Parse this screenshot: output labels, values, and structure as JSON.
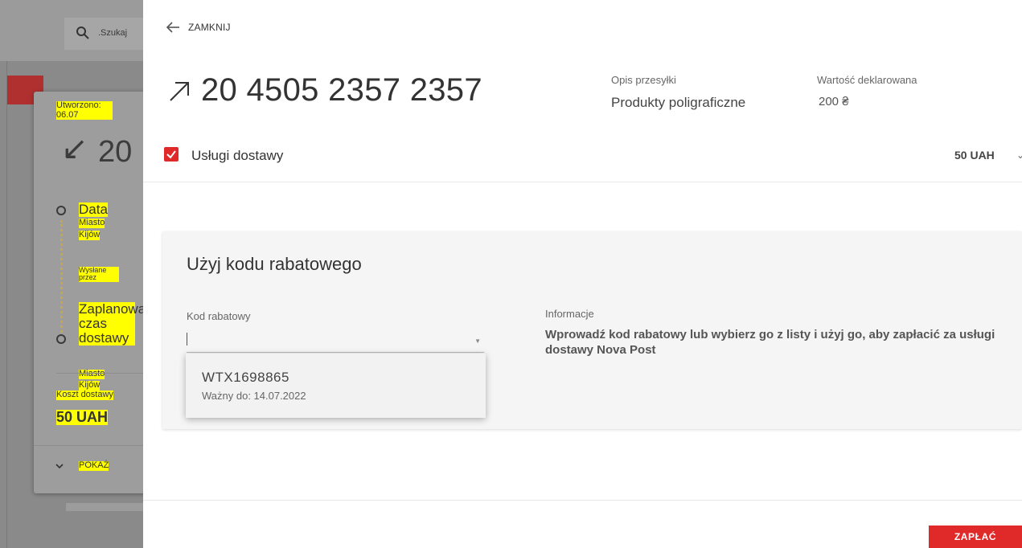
{
  "background": {
    "search_placeholder": ".Szukaj",
    "card": {
      "created": "Utworzono: 06.07",
      "arrow": "↙",
      "tracking_partial": "20",
      "data_label": "Data",
      "city_label_1": "Miasto",
      "city_value_1": "Kijów",
      "sent_by": "Wysłane przez",
      "planned_label": "Zaplanowany czas dostawy",
      "city_label_2": "Miasto",
      "city_value_2": "Kijów",
      "cost_label": "Koszt dostawy",
      "cost_value": "50 UAH",
      "show_label": "POKAŻ"
    }
  },
  "header": {
    "close_label": "ZAMKNIJ"
  },
  "shipment": {
    "tracking_number": "20 4505 2357 2357",
    "description_label": "Opis przesyłki",
    "description_value": "Produkty poligraficzne",
    "declared_value_label": "Wartość deklarowana",
    "declared_value": "200 ₴"
  },
  "services": {
    "label": "Usługi dostawy",
    "price": "50 UAH",
    "checked": true
  },
  "discount": {
    "title": "Użyj kodu rabatowego",
    "code_label": "Kod rabatowy",
    "code_value": "",
    "info_label": "Informacje",
    "info_text": "Wprowadź kod rabatowy lub wybierz go z listy i użyj go, aby zapłacić za usługi dostawy Nova Post",
    "options": [
      {
        "code": "WTX1698865",
        "valid": "Ważny do: 14.07.2022"
      }
    ]
  },
  "actions": {
    "pay_label": "ZAPŁAĆ"
  },
  "colors": {
    "accent": "#e02a2a",
    "highlight": "#ffff00"
  }
}
